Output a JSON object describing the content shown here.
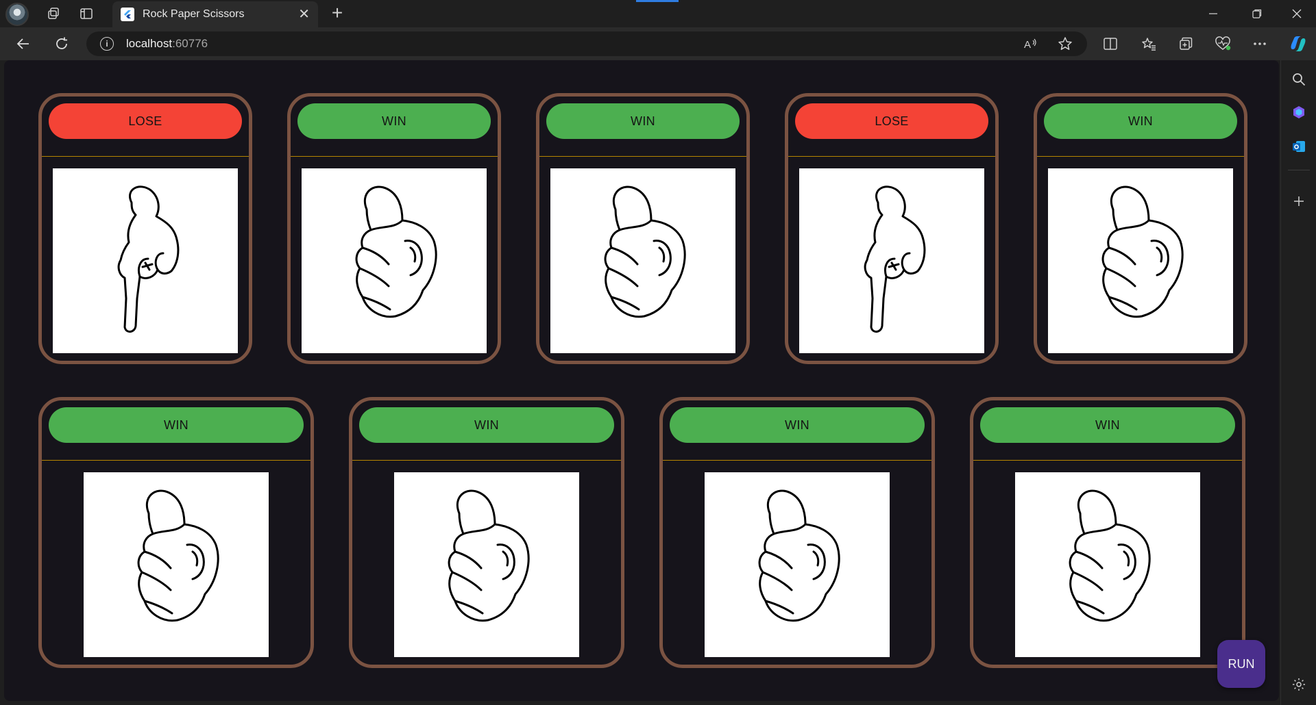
{
  "browser": {
    "tab_title": "Rock Paper Scissors",
    "url_host": "localhost",
    "url_port": ":60776"
  },
  "game": {
    "run_label": "RUN",
    "row1": [
      {
        "result": "LOSE",
        "hand": "scissors",
        "color": "#f44336"
      },
      {
        "result": "WIN",
        "hand": "rock",
        "color": "#4caf50"
      },
      {
        "result": "WIN",
        "hand": "rock",
        "color": "#4caf50"
      },
      {
        "result": "LOSE",
        "hand": "scissors",
        "color": "#f44336"
      },
      {
        "result": "WIN",
        "hand": "rock",
        "color": "#4caf50"
      }
    ],
    "row2": [
      {
        "result": "WIN",
        "hand": "rock",
        "color": "#4caf50"
      },
      {
        "result": "WIN",
        "hand": "rock",
        "color": "#4caf50"
      },
      {
        "result": "WIN",
        "hand": "rock",
        "color": "#4caf50"
      },
      {
        "result": "WIN",
        "hand": "rock",
        "color": "#4caf50"
      }
    ]
  },
  "colors": {
    "card_border": "#7b5342",
    "divider": "#b58400",
    "background": "#16141b",
    "run_button": "#4a2e8c"
  }
}
